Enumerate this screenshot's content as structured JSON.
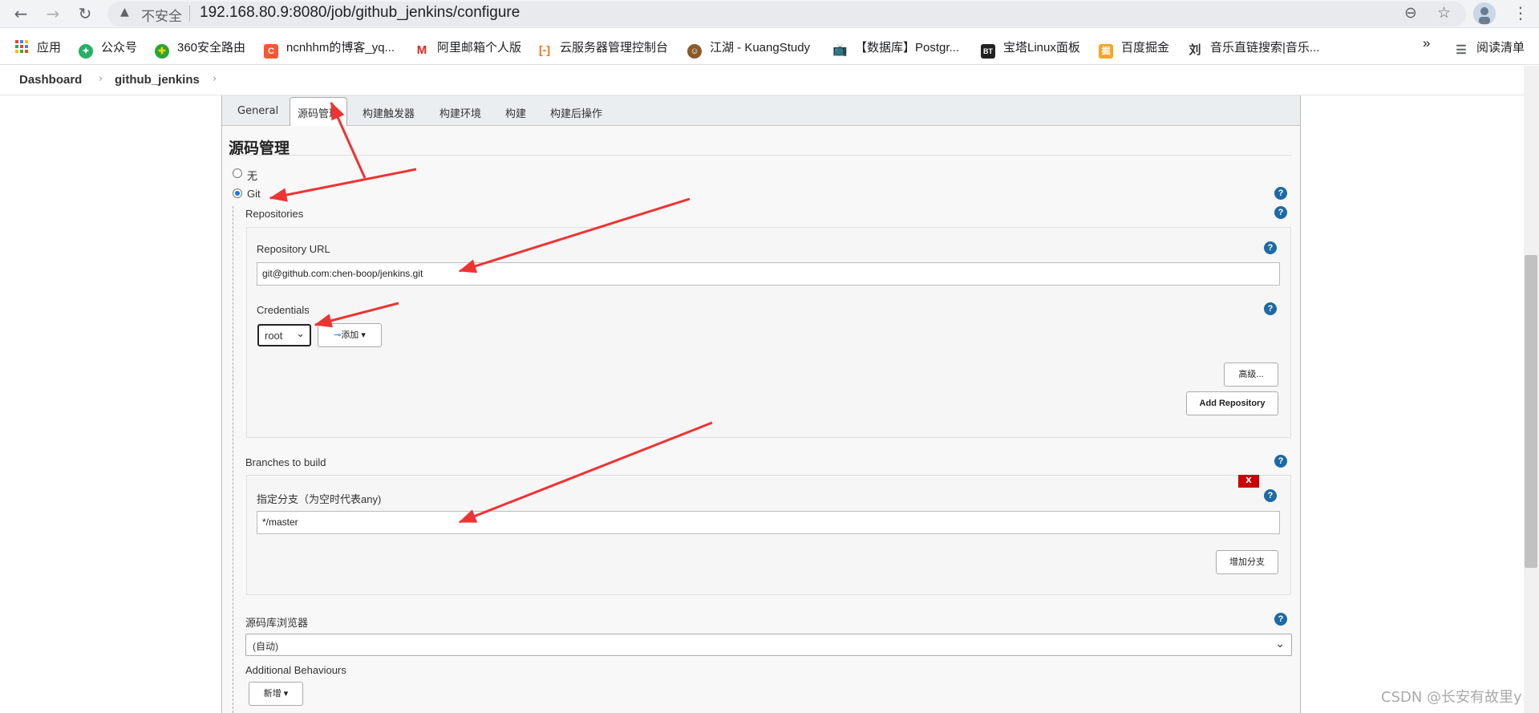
{
  "browser": {
    "back_icon": "←",
    "forward_icon": "→",
    "reload_icon": "↻",
    "warning_icon": "▲",
    "insecure_label": "不安全",
    "url": "192.168.80.9:8080/job/github_jenkins/configure",
    "zoom_icon": "⊖",
    "star_icon": "☆",
    "menu_icon": "⋮"
  },
  "bookmarks": {
    "items": [
      {
        "label": "应用",
        "icon": "apps-grid",
        "color": "#4285f4"
      },
      {
        "label": "公众号",
        "icon": "wechat",
        "color": "#2aae67"
      },
      {
        "label": "360安全路由",
        "icon": "plus",
        "color": "#2aa534"
      },
      {
        "label": "ncnhhm的博客_yq...",
        "icon": "C",
        "color": "#fc5531"
      },
      {
        "label": "阿里邮箱个人版",
        "icon": "M",
        "color": "#e2231a"
      },
      {
        "label": "云服务器管理控制台",
        "icon": "bracket",
        "color": "#ff6a00"
      },
      {
        "label": "江湖 - KuangStudy",
        "icon": "avatar",
        "color": "#8b5a2b"
      },
      {
        "label": "【数据库】Postgr...",
        "icon": "tv",
        "color": "#00a1d6"
      },
      {
        "label": "宝塔Linux面板",
        "icon": "BT",
        "color": "#222222"
      },
      {
        "label": "百度掘金",
        "icon": "掘",
        "color": "#f5a623"
      },
      {
        "label": "音乐直链搜索|音乐...",
        "icon": "刘",
        "color": "#333333"
      }
    ],
    "more_icon": "»",
    "reading_list": "阅读清单"
  },
  "breadcrumb": {
    "dashboard": "Dashboard",
    "sep": "›",
    "job": "github_jenkins"
  },
  "tabs": [
    "General",
    "源码管理",
    "构建触发器",
    "构建环境",
    "构建",
    "构建后操作"
  ],
  "scm": {
    "title": "源码管理",
    "radio_none": "无",
    "radio_git": "Git",
    "selected": "Git",
    "repositories_label": "Repositories",
    "repo_url_label": "Repository URL",
    "repo_url_value": "git@github.com:chen-boop/jenkins.git",
    "credentials_label": "Credentials",
    "credentials_value": "root",
    "add_button": "添加",
    "advanced_button": "高级...",
    "add_repository_button": "Add Repository",
    "branches_label": "Branches to build",
    "branch_spec_label": "指定分支（为空时代表any)",
    "branch_spec_value": "*/master",
    "delete_button": "X",
    "add_branch_button": "增加分支",
    "repo_browser_label": "源码库浏览器",
    "repo_browser_value": "(自动)",
    "additional_behaviours_label": "Additional Behaviours",
    "new_button": "新增",
    "help_icon": "?"
  },
  "annotation_color": "#ee3333",
  "watermark": "CSDN @长安有故里y"
}
